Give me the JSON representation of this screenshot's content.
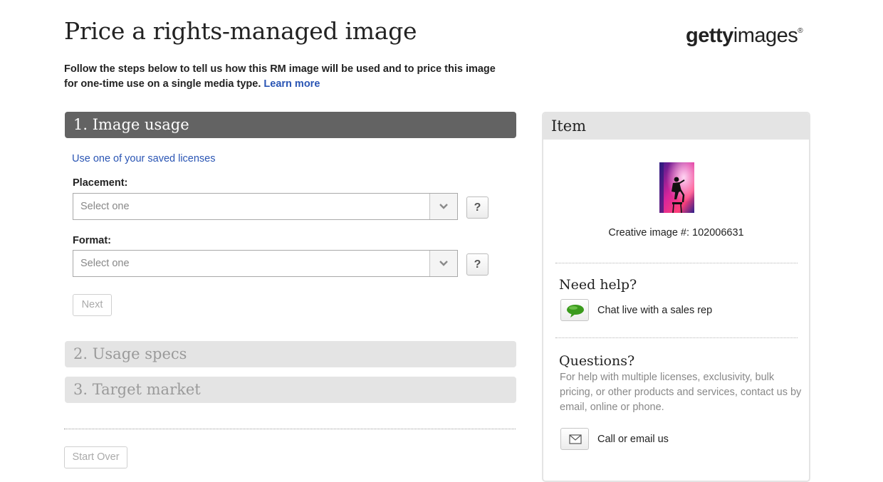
{
  "page": {
    "title": "Price a rights-managed image",
    "intro_text": "Follow the steps below to tell us how this RM image will be used and to price this image for one-time use on a single media type.",
    "learn_more_label": "Learn more"
  },
  "logo": {
    "bold": "getty",
    "rest": "images",
    "mark": "®"
  },
  "steps": [
    {
      "label": "1. Image usage",
      "state": "active"
    },
    {
      "label": "2. Usage specs",
      "state": "inactive"
    },
    {
      "label": "3. Target market",
      "state": "inactive"
    }
  ],
  "usage_form": {
    "saved_licenses_link": "Use one of your saved licenses",
    "placement": {
      "label": "Placement:",
      "value": "Select one",
      "help_label": "?"
    },
    "format": {
      "label": "Format:",
      "value": "Select one",
      "help_label": "?"
    },
    "next_label": "Next"
  },
  "start_over_label": "Start Over",
  "item_panel": {
    "title": "Item",
    "caption": "Creative image #: 102006631",
    "need_help": {
      "heading": "Need help?",
      "chat_label": "Chat live with a sales rep"
    },
    "questions": {
      "heading": "Questions?",
      "text": "For help with multiple licenses, exclusivity, bulk pricing, or other products and services, contact us by email, online or phone.",
      "contact_label": "Call or email us"
    }
  },
  "colors": {
    "link": "#2a55b4",
    "active_step_bg": "#636363",
    "inactive_step_bg": "#e4e4e4",
    "chat_bubble": "#3a9a1c"
  },
  "icons": [
    "chevron-down-icon",
    "chevron-down-icon",
    "chat-bubble-icon",
    "envelope-icon"
  ]
}
